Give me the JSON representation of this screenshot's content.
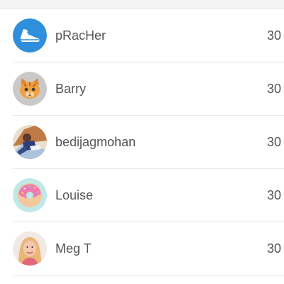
{
  "leaderboard": {
    "rows": [
      {
        "name": "pRacHer",
        "score": "30",
        "avatar": "running-shoe-icon"
      },
      {
        "name": "Barry",
        "score": "30",
        "avatar": "cat-face-avatar"
      },
      {
        "name": "bedijagmohan",
        "score": "30",
        "avatar": "person-photo-avatar"
      },
      {
        "name": "Louise",
        "score": "30",
        "avatar": "donut-avatar"
      },
      {
        "name": "Meg T",
        "score": "30",
        "avatar": "woman-photo-avatar"
      }
    ]
  },
  "colors": {
    "accent_blue": "#2f8fdc",
    "text": "#555555",
    "divider": "#e8e8e8"
  }
}
